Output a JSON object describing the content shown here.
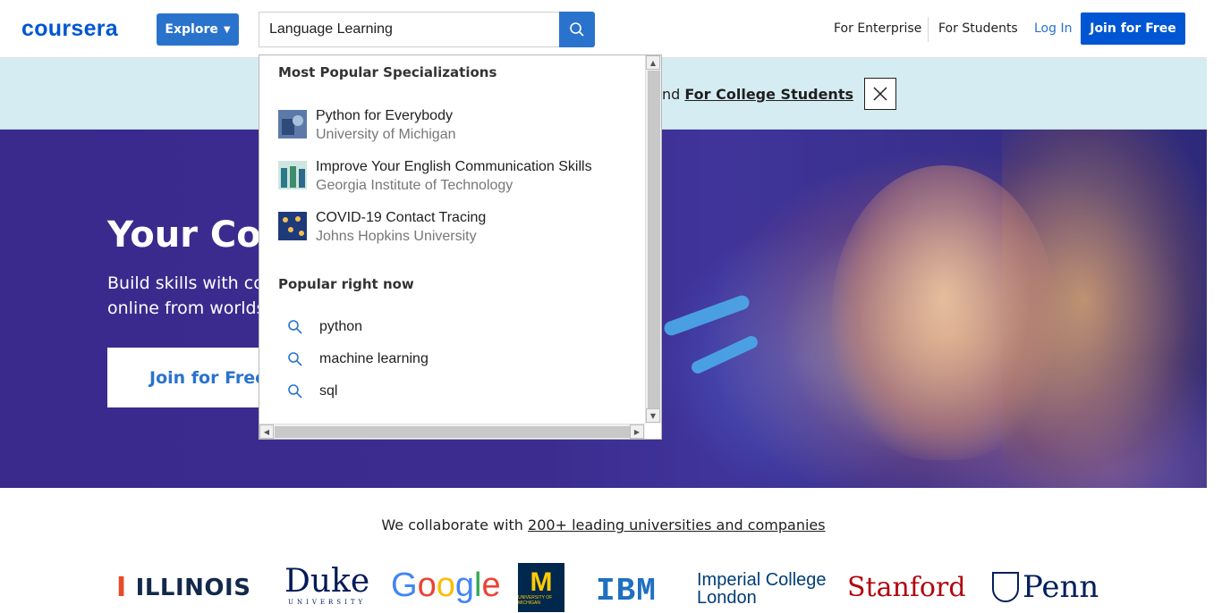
{
  "header": {
    "logo": "coursera",
    "explore_label": "Explore",
    "search_value": "Language Learning",
    "nav": {
      "enterprise": "For Enterprise",
      "students": "For Students",
      "login": "Log In",
      "join": "Join for Free"
    }
  },
  "banner": {
    "text_partial": "nd",
    "link": "For College Students"
  },
  "hero": {
    "title": "Your Cou",
    "sub_line1": "Build skills with co",
    "sub_line2": "online from worlds",
    "join": "Join for Free"
  },
  "dropdown": {
    "section1_title": "Most Popular Specializations",
    "items": [
      {
        "name": "Python for Everybody",
        "school": "University of Michigan"
      },
      {
        "name": "Improve Your English Communication Skills",
        "school": "Georgia Institute of Technology"
      },
      {
        "name": "COVID-19 Contact Tracing",
        "school": "Johns Hopkins University"
      }
    ],
    "section2_title": "Popular right now",
    "popular": [
      "python",
      "machine learning",
      "sql"
    ]
  },
  "partners": {
    "text": "We collaborate with ",
    "link": "200+ leading universities and companies",
    "logos": {
      "illinois": "ILLINOIS",
      "duke": "Duke",
      "duke_sub": "UNIVERSITY",
      "google": "Google",
      "michigan_sub": "UNIVERSITY OF MICHIGAN",
      "ibm": "IBM",
      "imperial_1": "Imperial College",
      "imperial_2": "London",
      "stanford": "Stanford",
      "penn": "Penn"
    }
  },
  "colors": {
    "brand": "#0056d2",
    "accent": "#2a73cc"
  }
}
